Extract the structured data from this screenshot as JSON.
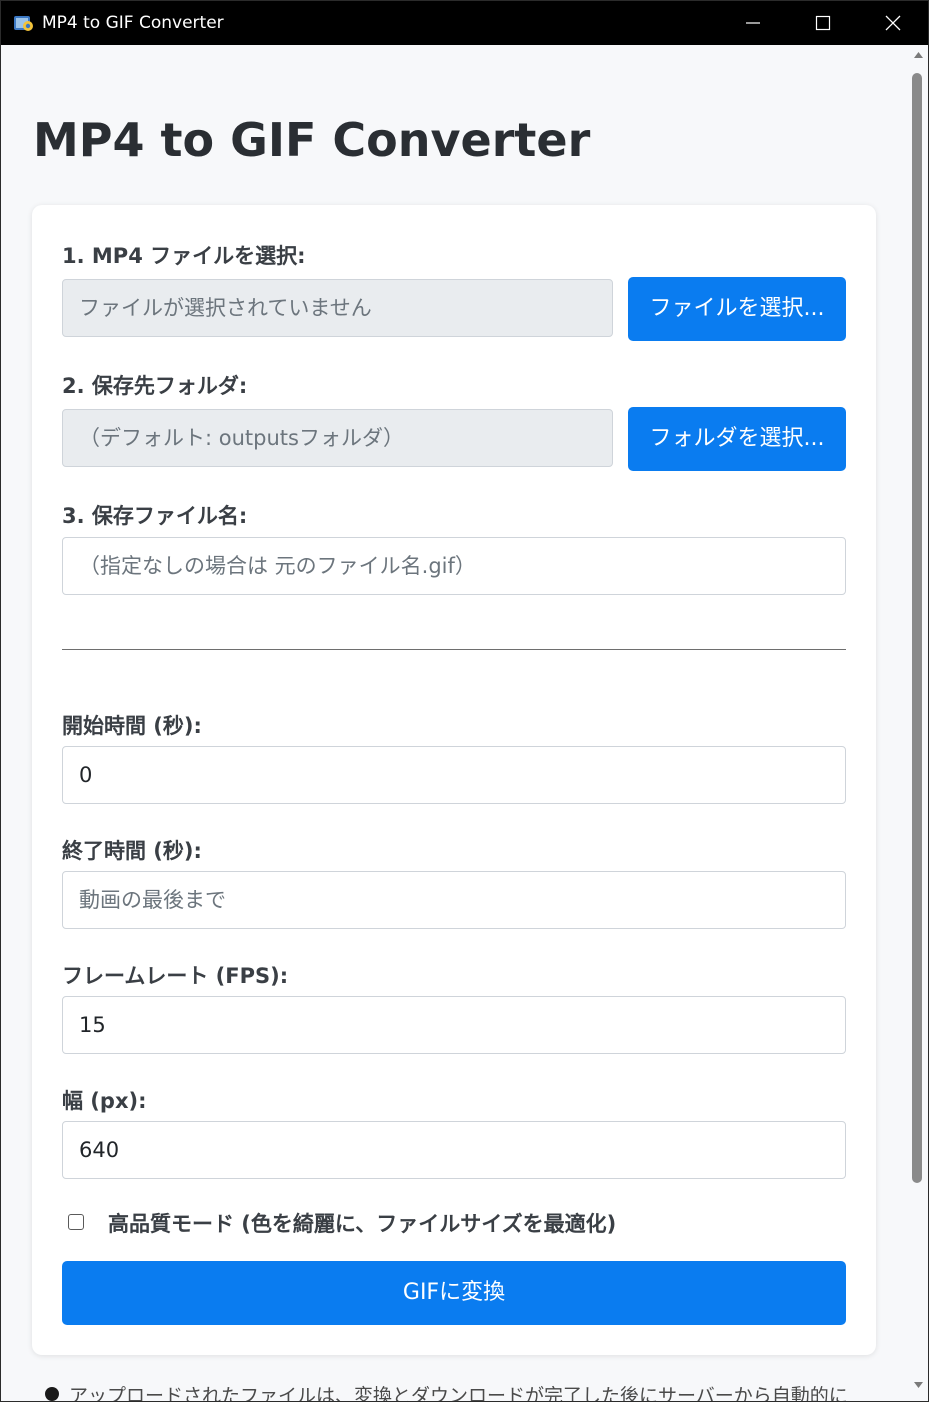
{
  "window": {
    "title": "MP4 to GIF Converter",
    "icon": "python-icon"
  },
  "page": {
    "title": "MP4 to GIF Converter"
  },
  "file_select": {
    "label": "1. MP4 ファイルを選択:",
    "value_placeholder": "ファイルが選択されていません",
    "button": "ファイルを選択..."
  },
  "folder_select": {
    "label": "2. 保存先フォルダ:",
    "value_placeholder": "（デフォルト: outputsフォルダ）",
    "button": "フォルダを選択..."
  },
  "filename": {
    "label": "3. 保存ファイル名:",
    "placeholder": "（指定なしの場合は 元のファイル名.gif）"
  },
  "start_time": {
    "label": "開始時間 (秒):",
    "value": "0"
  },
  "end_time": {
    "label": "終了時間 (秒):",
    "placeholder": "動画の最後まで"
  },
  "fps": {
    "label": "フレームレート (FPS):",
    "value": "15"
  },
  "width": {
    "label": "幅 (px):",
    "value": "640"
  },
  "high_quality": {
    "label": "高品質モード (色を綺麗に、ファイルサイズを最適化)",
    "checked": false
  },
  "convert_button": "GIFに変換",
  "footer_note": "アップロードされたファイルは、変換とダウンロードが完了した後にサーバーから自動的に",
  "colors": {
    "accent": "#0a7cf0",
    "titlebar": "#000000",
    "readonly_bg": "#e9ecef"
  }
}
